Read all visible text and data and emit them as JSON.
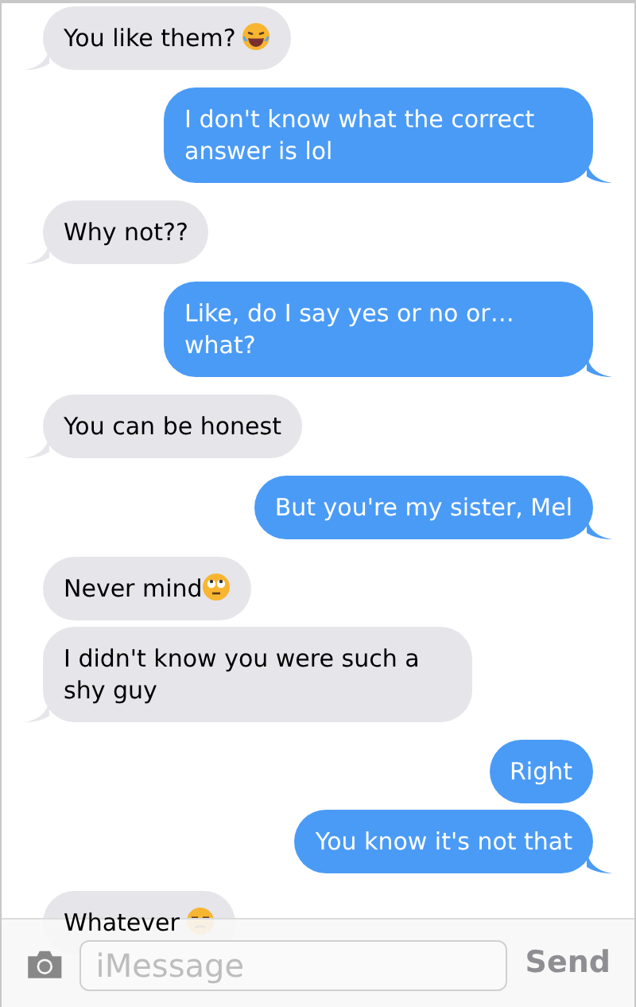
{
  "messages": [
    {
      "kind": "received",
      "text": "You like them?",
      "emoji": {
        "kind": "laughing"
      },
      "tail": true
    },
    {
      "kind": "sent",
      "text": "I don't know what the correct answer is lol",
      "tail": true
    },
    {
      "kind": "received",
      "text": "Why not??",
      "tail": true
    },
    {
      "kind": "sent",
      "text": "Like, do I say yes or no or… what?",
      "tail": true
    },
    {
      "kind": "received",
      "text": "You can be honest",
      "tail": true
    },
    {
      "kind": "sent",
      "text": "But you're my sister, Mel",
      "tail": true
    },
    {
      "kind": "received",
      "text": "Never mind",
      "emoji": {
        "kind": "eye-roll"
      },
      "tail": false
    },
    {
      "kind": "received",
      "text": "I didn't know you were such a shy guy",
      "tail": true
    },
    {
      "kind": "sent",
      "text": "Right",
      "tail": false
    },
    {
      "kind": "sent",
      "text": "You know it's not that",
      "tail": true
    },
    {
      "kind": "received",
      "text": "Whatever",
      "emoji": {
        "kind": "unamused"
      },
      "tail": false
    }
  ],
  "composer": {
    "placeholder": "iMessage",
    "send": "Send"
  }
}
